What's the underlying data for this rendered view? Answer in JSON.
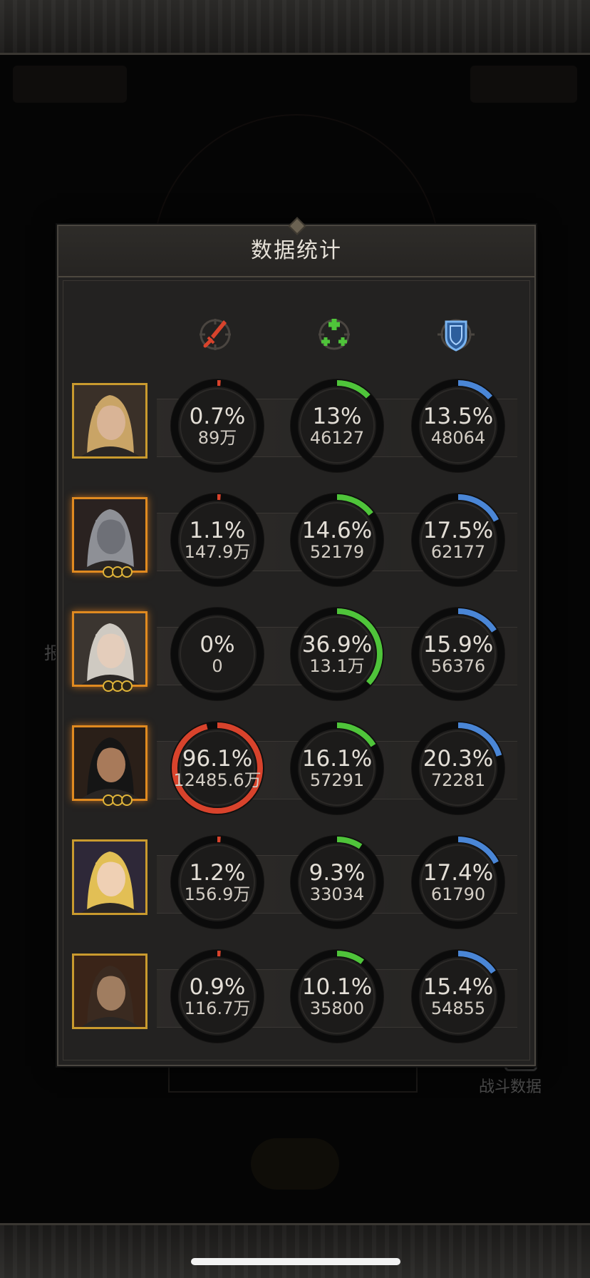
{
  "panel": {
    "title": "数据统计"
  },
  "background": {
    "battle_data_label": "战斗数据",
    "left_text": "报"
  },
  "columns": [
    {
      "name": "damage",
      "icon": "red-sword-icon",
      "color": "#d8432c"
    },
    {
      "name": "healing",
      "icon": "green-cross-icon",
      "color": "#4fc43a"
    },
    {
      "name": "damage-taken",
      "icon": "blue-shield-icon",
      "color": "#4a86d6"
    }
  ],
  "rows": [
    {
      "hero": "blonde-knight-portrait",
      "frame": "gold",
      "damage": {
        "percent": "0.7%",
        "value": "89万",
        "fraction": 0.007
      },
      "healing": {
        "percent": "13%",
        "value": "46127",
        "fraction": 0.13
      },
      "damage_taken": {
        "percent": "13.5%",
        "value": "48064",
        "fraction": 0.135
      }
    },
    {
      "hero": "werewolf-portrait",
      "frame": "orange",
      "damage": {
        "percent": "1.1%",
        "value": "147.9万",
        "fraction": 0.011
      },
      "healing": {
        "percent": "14.6%",
        "value": "52179",
        "fraction": 0.146
      },
      "damage_taken": {
        "percent": "17.5%",
        "value": "62177",
        "fraction": 0.175
      }
    },
    {
      "hero": "silver-crowned-priestess-portrait",
      "frame": "orange",
      "damage": {
        "percent": "0%",
        "value": "0",
        "fraction": 0
      },
      "healing": {
        "percent": "36.9%",
        "value": "13.1万",
        "fraction": 0.369
      },
      "damage_taken": {
        "percent": "15.9%",
        "value": "56376",
        "fraction": 0.159
      }
    },
    {
      "hero": "dark-haired-warrior-portrait",
      "frame": "orange",
      "damage": {
        "percent": "96.1%",
        "value": "12485.6万",
        "fraction": 0.961
      },
      "healing": {
        "percent": "16.1%",
        "value": "57291",
        "fraction": 0.161
      },
      "damage_taken": {
        "percent": "20.3%",
        "value": "72281",
        "fraction": 0.203
      }
    },
    {
      "hero": "golden-haired-maiden-portrait",
      "frame": "gold",
      "damage": {
        "percent": "1.2%",
        "value": "156.9万",
        "fraction": 0.012
      },
      "healing": {
        "percent": "9.3%",
        "value": "33034",
        "fraction": 0.093
      },
      "damage_taken": {
        "percent": "17.4%",
        "value": "61790",
        "fraction": 0.174
      }
    },
    {
      "hero": "bearded-warrior-portrait",
      "frame": "gold",
      "damage": {
        "percent": "0.9%",
        "value": "116.7万",
        "fraction": 0.009
      },
      "healing": {
        "percent": "10.1%",
        "value": "35800",
        "fraction": 0.101
      },
      "damage_taken": {
        "percent": "15.4%",
        "value": "54855",
        "fraction": 0.154
      }
    }
  ]
}
